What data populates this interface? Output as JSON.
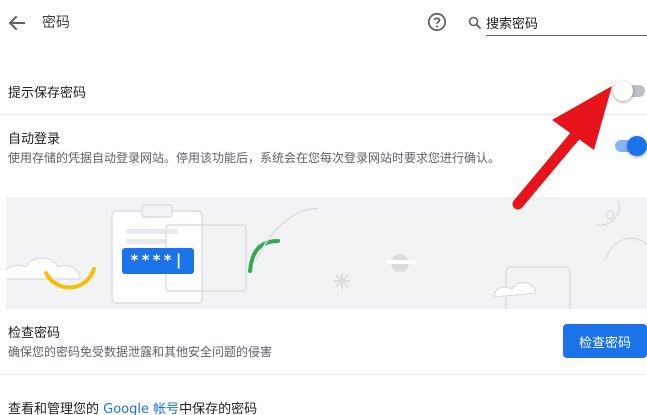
{
  "header": {
    "title": "密码",
    "back_icon": "back-arrow-icon",
    "help_icon": "help-icon",
    "search_icon": "search-icon",
    "search_value": "搜索密码"
  },
  "offer_save": {
    "label": "提示保存密码",
    "enabled": false
  },
  "auto_signin": {
    "label": "自动登录",
    "description": "使用存储的凭据自动登录网站。停用该功能后，系统会在您每次登录网站时要求您进行确认。",
    "enabled": true
  },
  "illustration": {
    "password_mask": "****|"
  },
  "check_passwords": {
    "title": "检查密码",
    "description": "确保您的密码免受数据泄露和其他安全问题的侵害",
    "button_label": "检查密码"
  },
  "manage": {
    "prefix": "查看和管理您的 ",
    "link_text": "Google 帐号",
    "suffix": "中保存的密码"
  },
  "colors": {
    "accent": "#1a73e8",
    "toggle_on_track": "#8ab4f8",
    "toggle_off_track": "#bdc1c6",
    "arrow": "#e8141b"
  }
}
